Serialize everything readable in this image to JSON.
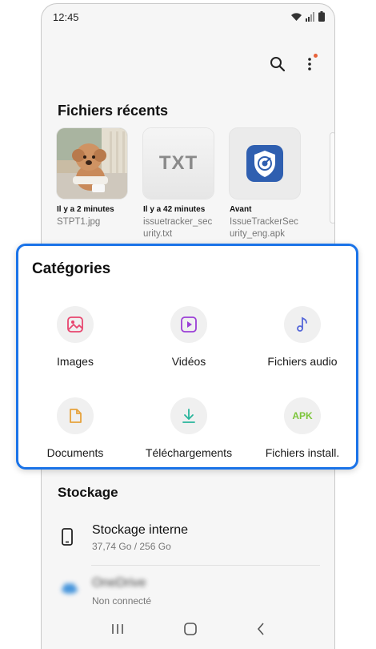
{
  "status_bar": {
    "time": "12:45"
  },
  "top_actions": {
    "search_icon": "search-icon",
    "more_icon": "more-vert-icon",
    "notification_color": "#e8623a"
  },
  "recent": {
    "title": "Fichiers récents",
    "items": [
      {
        "time": "Il y a 2 minutes",
        "name": "STPT1.jpg",
        "thumb": "photo-dog"
      },
      {
        "time": "Il y a 42 minutes",
        "name": "issuetracker_security.txt",
        "thumb": "TXT"
      },
      {
        "time": "Avant",
        "name": "IssueTrackerSecurity_eng.apk",
        "thumb": "app-shield"
      }
    ]
  },
  "categories": {
    "title": "Catégories",
    "highlight_color": "#1a73e8",
    "items": [
      {
        "label": "Images",
        "icon": "image-icon",
        "color": "#e8466f"
      },
      {
        "label": "Vidéos",
        "icon": "video-icon",
        "color": "#9b3fd6"
      },
      {
        "label": "Fichiers audio",
        "icon": "music-note-icon",
        "color": "#5567d9"
      },
      {
        "label": "Documents",
        "icon": "document-icon",
        "color": "#e6a23c"
      },
      {
        "label": "Téléchargements",
        "icon": "download-icon",
        "color": "#27b59b"
      },
      {
        "label": "Fichiers install.",
        "icon_text": "APK",
        "icon": "apk-icon",
        "color": "#7cc53a"
      }
    ]
  },
  "storage": {
    "title": "Stockage",
    "internal": {
      "name": "Stockage interne",
      "usage": "37,74 Go / 256 Go"
    },
    "onedrive": {
      "name": "OneDrive",
      "status": "Non connecté"
    }
  }
}
